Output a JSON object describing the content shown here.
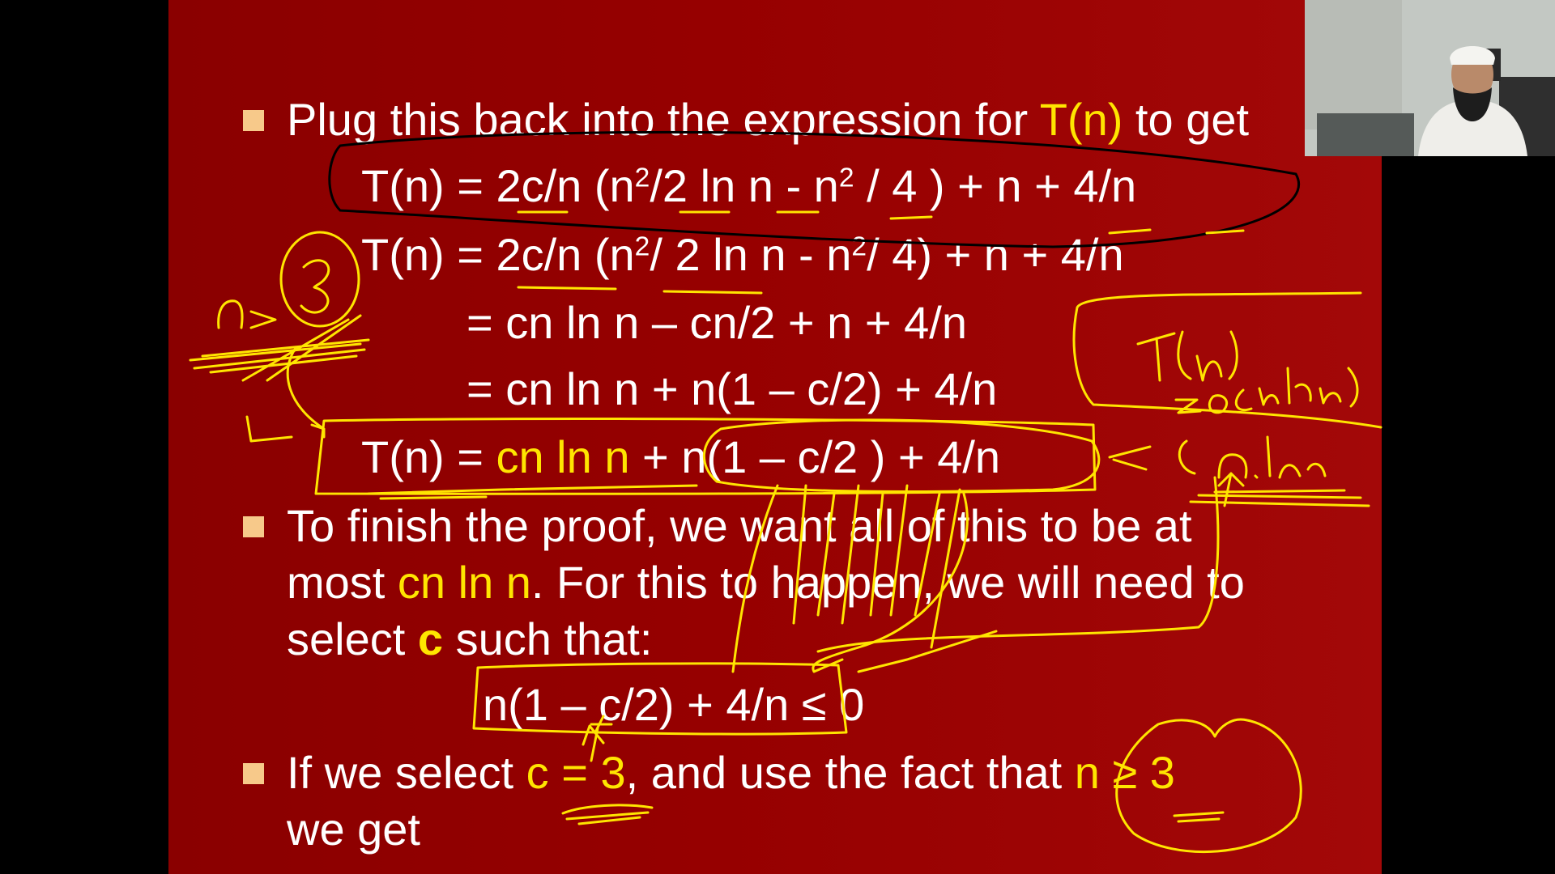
{
  "slide": {
    "bullet1": {
      "pre": "Plug this back into the expression for ",
      "hl": "T(n)",
      "post": " to get"
    },
    "eq1": {
      "a": "T(n) = 2c/n (n",
      "b": "/2 ln n - n",
      "c": " / 4 ) + n + 4/n"
    },
    "eq2": {
      "a": "T(n) = 2c/n (n",
      "b": "/ 2 ln n - n",
      "c": "/ 4) + n + 4/n"
    },
    "eq3": "= cn ln n – cn/2   + n  + 4/n",
    "eq4": "= cn ln n + n(1  – c/2) + 4/n",
    "eq5": {
      "a": "T(n) = ",
      "hl": "cn ln n",
      "b": " + n(1 – c/2 ) + 4/n"
    },
    "bullet2": {
      "line1": "To finish the proof, we want all of this to be at",
      "line2_pre": "most ",
      "line2_hl": "cn ln n",
      "line2_post": ". For this to happen, we will need to",
      "line3_pre": "select ",
      "line3_hl": "c",
      "line3_post": " such that:"
    },
    "ineq": "n(1 – c/2)  + 4/n ≤ 0",
    "bullet3": {
      "pre": "If we select ",
      "hl1": "c = 3",
      "mid": ", and use the fact that ",
      "hl2": "n ≥ 3",
      "line2": "we get"
    },
    "sup": "2"
  },
  "annotations": {
    "ink_color": "#ffe500",
    "ink_secondary": "#000000",
    "note_box": "T(n) = O(n ln n)",
    "note_arrow": "c n.ln n",
    "note_left": "n > 3"
  }
}
